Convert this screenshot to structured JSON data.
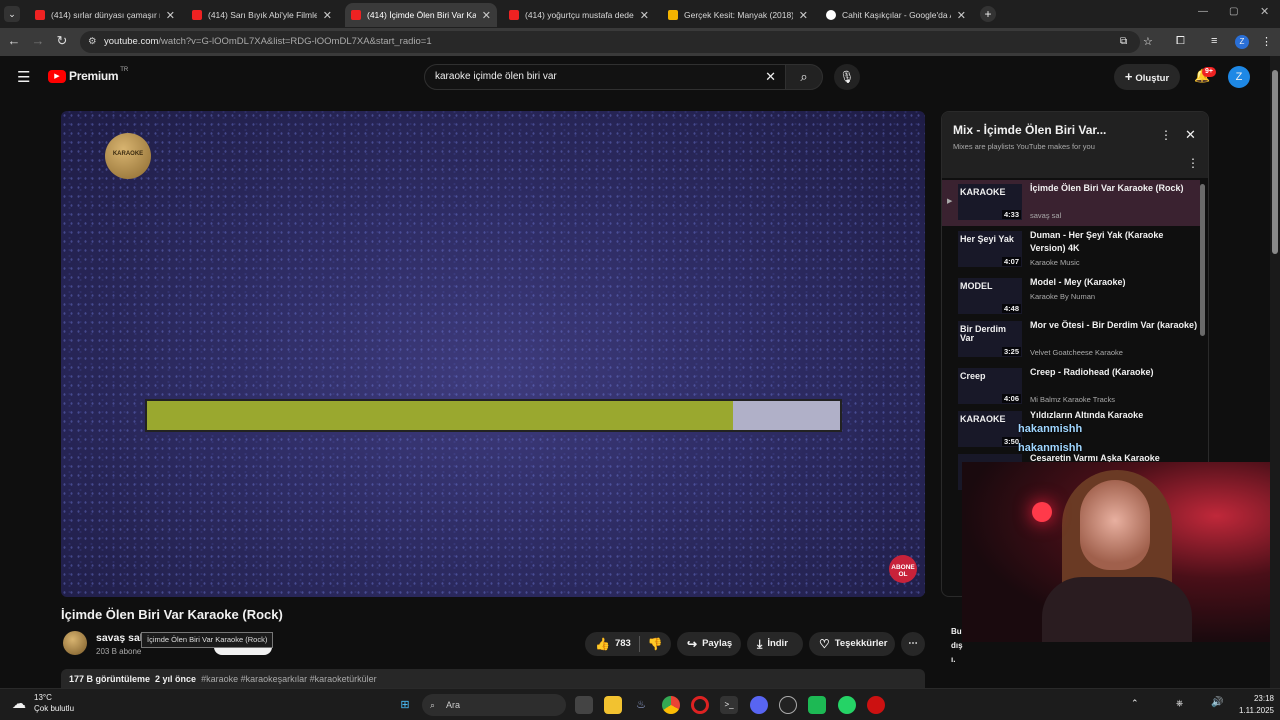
{
  "browser": {
    "tabs": [
      {
        "title": "(414) sırlar dünyası çamaşır ma",
        "active": false
      },
      {
        "title": "(414) Sarı Bıyık Abi'yle Filmler (",
        "active": false
      },
      {
        "title": "(414) İçimde Ölen Biri Var Karao",
        "active": true
      },
      {
        "title": "(414) yoğurtçu mustafa dede -",
        "active": false
      },
      {
        "title": "Gerçek Kesit: Manyak (2018) - I",
        "active": false
      },
      {
        "title": "Cahit Kaşıkçılar - Google'da Ara",
        "active": false
      }
    ],
    "url_host": "youtube.com",
    "url_path": "/watch?v=G-lOOmDL7XA&list=RDG-lOOmDL7XA&start_radio=1",
    "profile_initial": "Z"
  },
  "youtube": {
    "logo_text": "Premium",
    "logo_region": "TR",
    "search_value": "karaoke içimde ölen biri var",
    "create_label": "Oluştur",
    "notif_badge": "9+",
    "avatar_initial": "Z"
  },
  "player": {
    "logo_text": "KARAOKE",
    "progress_fraction": 0.845,
    "subscribe_line1": "ABONE",
    "subscribe_line2": "OL"
  },
  "video": {
    "title": "İçimde Ölen Biri Var Karaoke (Rock)",
    "channel": "savaş sal",
    "subscribers": "203 B abone",
    "tooltip": "İçimde Ölen Biri Var Karaoke (Rock)",
    "likes": "783",
    "share_label": "Paylaş",
    "download_label": "İndir",
    "thanks_label": "Teşekkürler",
    "views": "177 B görüntüleme",
    "age": "2 yıl önce",
    "tags": "#karaoke #karaokeşarkılar #karaoketürküler"
  },
  "playlist": {
    "title": "Mix - İçimde Ölen Biri Var...",
    "subtitle": "Mixes are playlists YouTube makes for you",
    "items": [
      {
        "title": "İçimde Ölen Biri Var Karaoke (Rock)",
        "channel": "savaş sal",
        "duration": "4:33",
        "thumb_text": "KARAOKE"
      },
      {
        "title": "Duman - Her Şeyi Yak (Karaoke Version) 4K",
        "channel": "Karaoke Music",
        "duration": "4:07",
        "thumb_text": "Her Şeyi Yak"
      },
      {
        "title": "Model - Mey (Karaoke)",
        "channel": "Karaoke By Numan",
        "duration": "4:48",
        "thumb_text": "MODEL"
      },
      {
        "title": "Mor ve Ötesi - Bir Derdim Var (karaoke)",
        "channel": "Velvet Goatcheese Karaoke",
        "duration": "3:25",
        "thumb_text": "Bir Derdim Var"
      },
      {
        "title": "Creep - Radiohead (Karaoke)",
        "channel": "Mi Balmz Karaoke Tracks",
        "duration": "4:06",
        "thumb_text": "Creep"
      },
      {
        "title": "Yıldızların Altında Karaoke",
        "channel": "",
        "duration": "3:50",
        "thumb_text": "KARAOKE"
      },
      {
        "title": "Cesaretin Varmı Aşka Karaoke",
        "channel": "",
        "duration": "",
        "thumb_text": ""
      }
    ]
  },
  "overlay": {
    "chat_names": [
      "hakanmishh",
      "hakanmishh"
    ],
    "side_text": "Bu dışı."
  },
  "taskbar": {
    "temperature": "13°C",
    "weather": "Çok bulutlu",
    "search_placeholder": "Ara",
    "time": "23:18",
    "date": "1.11.2025"
  }
}
